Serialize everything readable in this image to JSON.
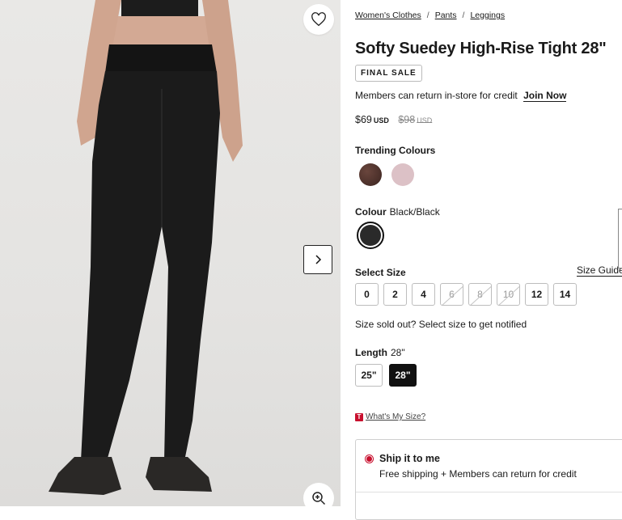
{
  "breadcrumb": [
    "Women's Clothes",
    "Pants",
    "Leggings"
  ],
  "product": {
    "title": "Softy Suedey High-Rise Tight 28\"",
    "badge": "FINAL SALE"
  },
  "members": {
    "text": "Members can return in-store for credit",
    "link": "Join Now"
  },
  "price": {
    "current": "$69",
    "currency": "USD",
    "original": "$98"
  },
  "trending": {
    "label": "Trending Colours",
    "swatches": [
      {
        "name": "brown-pattern",
        "color": "#4a2e28"
      },
      {
        "name": "pink",
        "color": "#dcc1c6"
      }
    ]
  },
  "colour": {
    "label": "Colour",
    "value": "Black/Black",
    "swatch_color": "#2a2a2a"
  },
  "size": {
    "label": "Select Size",
    "guide": "Size Guide",
    "options": [
      {
        "label": "0",
        "available": true
      },
      {
        "label": "2",
        "available": true
      },
      {
        "label": "4",
        "available": true
      },
      {
        "label": "6",
        "available": false
      },
      {
        "label": "8",
        "available": false
      },
      {
        "label": "10",
        "available": false
      },
      {
        "label": "12",
        "available": true
      },
      {
        "label": "14",
        "available": true
      }
    ],
    "sold_out_text": "Size sold out? Select size to get notified"
  },
  "length": {
    "label": "Length",
    "value": "28\"",
    "options": [
      "25\"",
      "28\""
    ],
    "selected": "28\""
  },
  "whats_my_size": {
    "badge": "T",
    "text": "What's My Size?"
  },
  "shipping": {
    "title": "Ship it to me",
    "subtitle": "Free shipping + Members can return for credit"
  },
  "colors": {
    "accent": "#c8102e",
    "dark": "#111111"
  }
}
